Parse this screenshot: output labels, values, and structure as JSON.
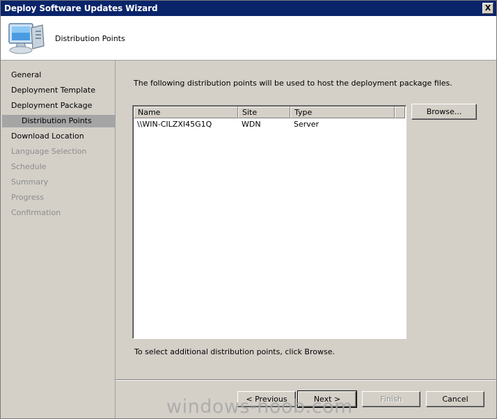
{
  "window": {
    "title": "Deploy Software Updates Wizard",
    "close_label": "X"
  },
  "header": {
    "title": "Distribution Points",
    "icon": "computer-icon"
  },
  "sidebar": {
    "items": [
      {
        "label": "General",
        "state": "normal"
      },
      {
        "label": "Deployment Template",
        "state": "normal"
      },
      {
        "label": "Deployment Package",
        "state": "normal"
      },
      {
        "label": "Distribution Points",
        "state": "active"
      },
      {
        "label": "Download Location",
        "state": "normal"
      },
      {
        "label": "Language Selection",
        "state": "disabled"
      },
      {
        "label": "Schedule",
        "state": "disabled"
      },
      {
        "label": "Summary",
        "state": "disabled"
      },
      {
        "label": "Progress",
        "state": "disabled"
      },
      {
        "label": "Confirmation",
        "state": "disabled"
      }
    ]
  },
  "main": {
    "intro": "The following distribution points will be used to host the deployment package files.",
    "columns": [
      "Name",
      "Site",
      "Type"
    ],
    "rows": [
      {
        "name": "\\\\WIN-CILZXI45G1Q",
        "site": "WDN",
        "type": "Server"
      }
    ],
    "browse_label": "Browse...",
    "footnote": "To select additional distribution points, click Browse."
  },
  "buttons": {
    "previous": "< Previous",
    "next": "Next >",
    "finish": "Finish",
    "cancel": "Cancel"
  },
  "watermark": "windows-noob.com"
}
